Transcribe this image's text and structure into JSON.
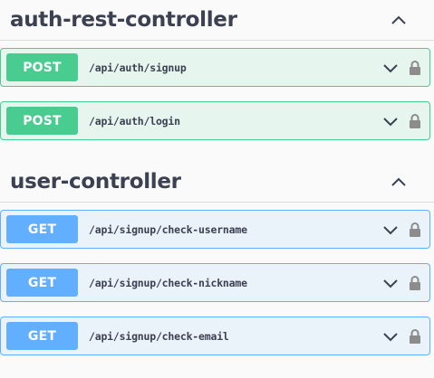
{
  "sections": [
    {
      "title": "auth-rest-controller",
      "operations": [
        {
          "method": "POST",
          "path": "/api/auth/signup"
        },
        {
          "method": "POST",
          "path": "/api/auth/login"
        }
      ]
    },
    {
      "title": "user-controller",
      "operations": [
        {
          "method": "GET",
          "path": "/api/signup/check-username"
        },
        {
          "method": "GET",
          "path": "/api/signup/check-nickname"
        },
        {
          "method": "GET",
          "path": "/api/signup/check-email"
        }
      ]
    }
  ],
  "icons": {
    "collapse": "chevron-up-icon",
    "expand": "chevron-down-icon",
    "lock": "lock-icon"
  },
  "colors": {
    "post": "#49cc90",
    "get": "#61affe",
    "text": "#3b4151"
  }
}
